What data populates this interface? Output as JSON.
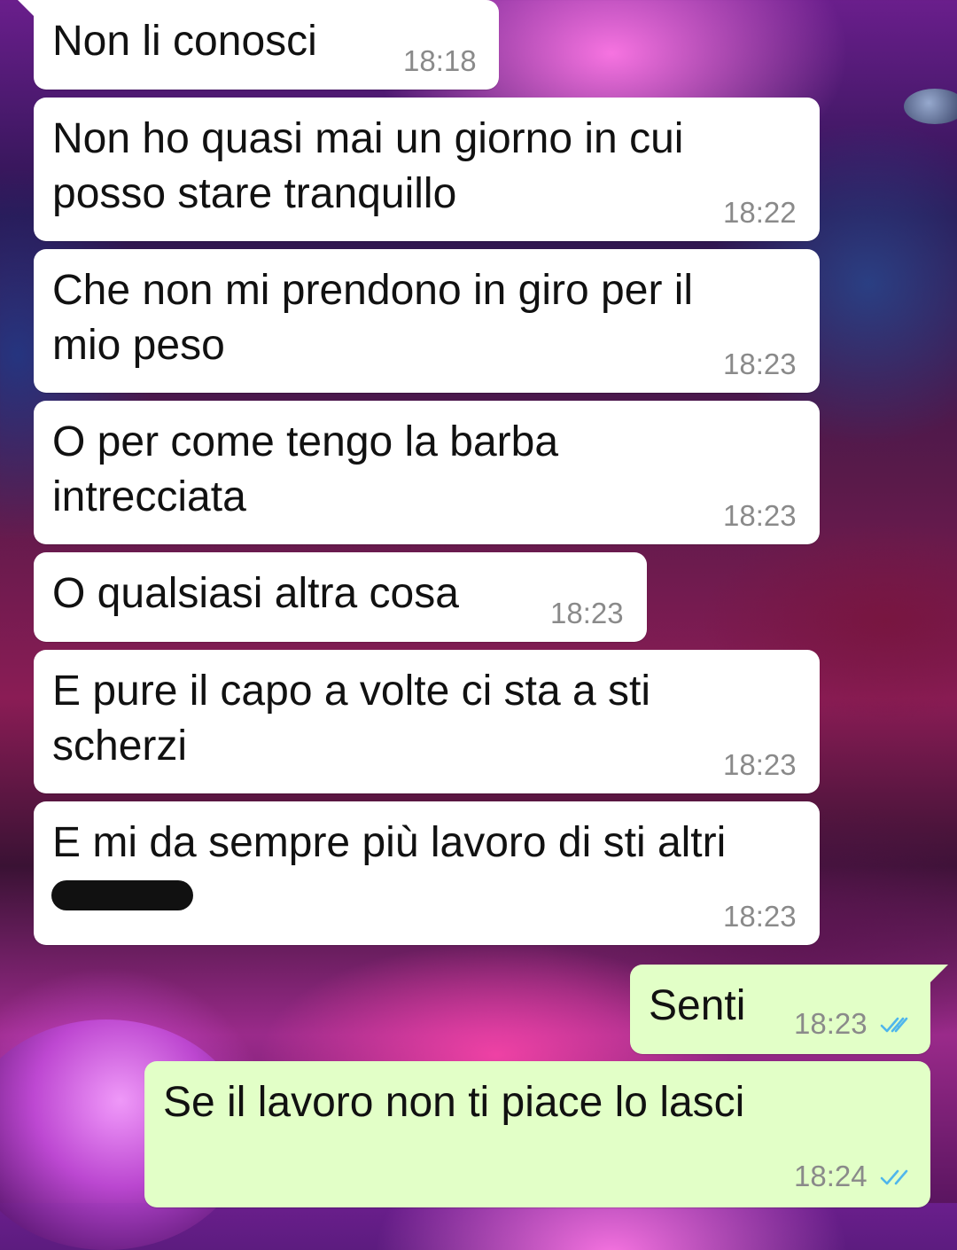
{
  "chat": {
    "messages": [
      {
        "text": "Non li conosci",
        "time": "18:18",
        "direction": "in"
      },
      {
        "text": "Non ho quasi mai un giorno in cui\nposso stare tranquillo",
        "time": "18:22",
        "direction": "in"
      },
      {
        "text": "Che non mi prendono in giro per il\nmio peso",
        "time": "18:23",
        "direction": "in"
      },
      {
        "text": "O per come tengo la barba\nintrecciata",
        "time": "18:23",
        "direction": "in"
      },
      {
        "text": "O qualsiasi altra cosa",
        "time": "18:23",
        "direction": "in"
      },
      {
        "text": "E pure il capo a volte ci sta a sti\nscherzi",
        "time": "18:23",
        "direction": "in"
      },
      {
        "text": "E mi da sempre più lavoro di sti altri",
        "time": "18:23",
        "direction": "in"
      },
      {
        "text": "Senti",
        "time": "18:23",
        "direction": "out",
        "status": "read-double-check-icon"
      },
      {
        "text": "Se il lavoro non ti piace lo lasci",
        "time": "18:24",
        "direction": "out",
        "status": "read-double-check-icon"
      }
    ]
  },
  "colors": {
    "incoming_bubble": "#ffffff",
    "outgoing_bubble": "#e2ffc7",
    "timestamp": "#8a8a8a",
    "read_ticks": "#4fb6ec"
  }
}
